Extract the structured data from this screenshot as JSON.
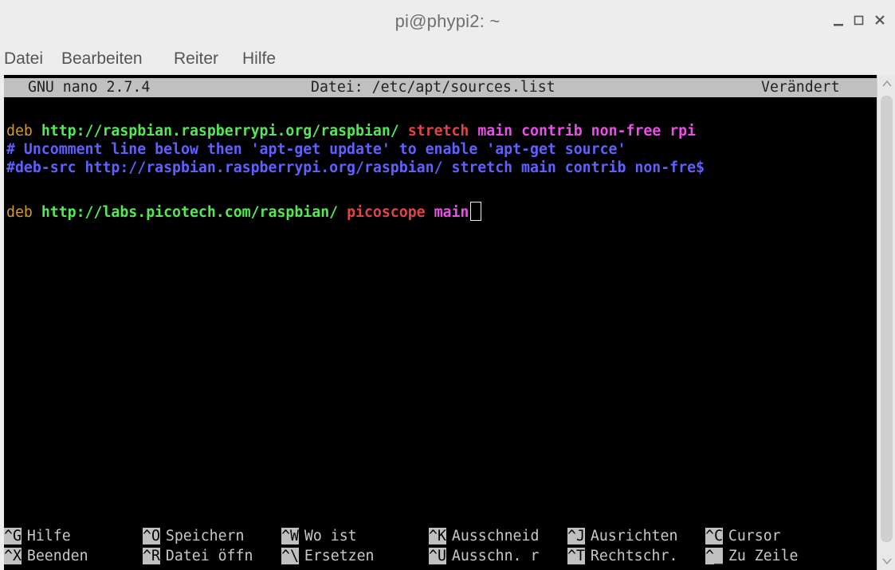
{
  "window": {
    "title": "pi@phypi2: ~"
  },
  "menu": [
    "Datei",
    "Bearbeiten",
    "Reiter",
    "Hilfe"
  ],
  "nano": {
    "version": "GNU nano 2.7.4",
    "file": "Datei: /etc/apt/sources.list",
    "status": "Verändert"
  },
  "lines": {
    "l1": {
      "deb": "deb",
      "url": "http://raspbian.raspberrypi.org/raspbian/",
      "dist": "stretch",
      "comp": "main contrib non-free rpi"
    },
    "l2": "# Uncomment line below then 'apt-get update' to enable 'apt-get source'",
    "l3": "#deb-src http://raspbian.raspberrypi.org/raspbian/ stretch main contrib non-fre$",
    "l5": {
      "deb": "deb",
      "url": "http://labs.picotech.com/raspbian/",
      "dist": "picoscope",
      "comp": "main"
    }
  },
  "shortcuts": {
    "row1": [
      {
        "key": "^G",
        "label": "Hilfe"
      },
      {
        "key": "^O",
        "label": "Speichern"
      },
      {
        "key": "^W",
        "label": "Wo ist"
      },
      {
        "key": "^K",
        "label": "Ausschneid"
      },
      {
        "key": "^J",
        "label": "Ausrichten"
      },
      {
        "key": "^C",
        "label": "Cursor"
      }
    ],
    "row2": [
      {
        "key": "^X",
        "label": "Beenden"
      },
      {
        "key": "^R",
        "label": "Datei öffn"
      },
      {
        "key": "^\\",
        "label": "Ersetzen"
      },
      {
        "key": "^U",
        "label": "Ausschn. r"
      },
      {
        "key": "^T",
        "label": "Rechtschr."
      },
      {
        "key": "^_",
        "label": "Zu Zeile"
      }
    ]
  }
}
